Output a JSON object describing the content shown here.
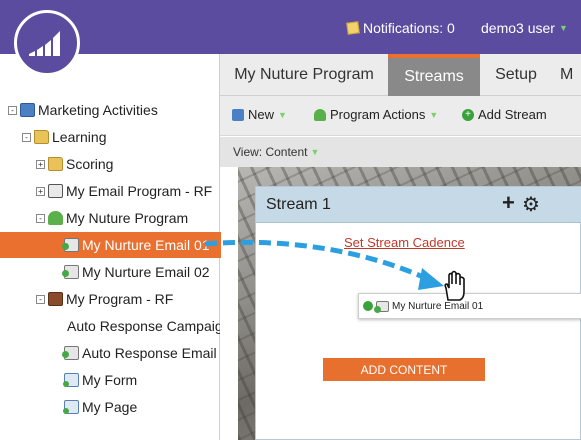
{
  "header": {
    "notifications_label": "Notifications: 0",
    "user_label": "demo3 user"
  },
  "sidebar": {
    "items": [
      {
        "label": "Marketing Activities",
        "icon": "marketing-activities-icon"
      },
      {
        "label": "Learning",
        "icon": "folder-icon"
      },
      {
        "label": "Scoring",
        "icon": "folder-icon"
      },
      {
        "label": "My Email Program - RF",
        "icon": "email-program-icon"
      },
      {
        "label": "My Nuture Program",
        "icon": "nurture-program-icon"
      },
      {
        "label": "My Nurture Email 01",
        "icon": "email-icon",
        "selected": true
      },
      {
        "label": "My Nurture Email 02",
        "icon": "email-icon"
      },
      {
        "label": "My Program - RF",
        "icon": "program-icon"
      },
      {
        "label": "Auto Response Campaign",
        "icon": "lightbulb-icon"
      },
      {
        "label": "Auto Response Email",
        "icon": "email-icon"
      },
      {
        "label": "My Form",
        "icon": "form-icon"
      },
      {
        "label": "My Page",
        "icon": "page-icon"
      }
    ]
  },
  "tabs": [
    {
      "label": "My Nuture Program",
      "active": false
    },
    {
      "label": "Streams",
      "active": true
    },
    {
      "label": "Setup",
      "active": false
    },
    {
      "label": "M",
      "active": false
    }
  ],
  "toolbar": {
    "new_label": "New",
    "program_actions_label": "Program Actions",
    "add_stream_label": "Add Stream"
  },
  "view": {
    "label": "View: Content"
  },
  "stream": {
    "title": "Stream 1",
    "cadence_link": "Set Stream Cadence",
    "dragged_item_label": "My Nurture Email 01",
    "add_content_label": "ADD CONTENT"
  },
  "colors": {
    "brand_purple": "#5c4c9f",
    "accent_orange": "#e9702f",
    "stream_header": "#c5d9e6",
    "link_red": "#c0392b"
  }
}
